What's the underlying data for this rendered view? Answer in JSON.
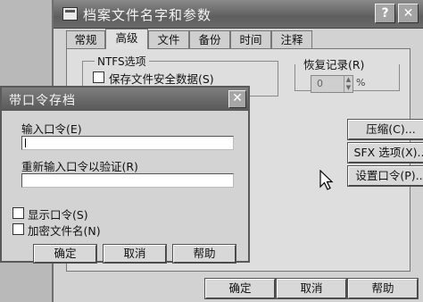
{
  "main": {
    "title": "档案文件名字和参数",
    "help_glyph": "?",
    "close_glyph": "✕",
    "tabs": [
      {
        "label": "常规",
        "active": false
      },
      {
        "label": "高级",
        "active": true
      },
      {
        "label": "文件",
        "active": false
      },
      {
        "label": "备份",
        "active": false
      },
      {
        "label": "时间",
        "active": false
      },
      {
        "label": "注释",
        "active": false
      }
    ],
    "ntfs_legend": "NTFS选项",
    "save_security_label": "保存文件安全数据(S)",
    "recovery_legend": "恢复记录(R)",
    "recovery_value": "0",
    "recovery_unit": "%",
    "compress_button": "压缩(C)...",
    "sfx_button": "SFX 选项(X)...",
    "set_password_button": "设置口令(P)...",
    "ok_button": "确定",
    "cancel_button": "取消",
    "help_button": "帮助"
  },
  "password": {
    "title": "带口令存档",
    "close_glyph": "✕",
    "enter_label": "输入口令(E)",
    "reenter_label": "重新输入口令以验证(R)",
    "show_label": "显示口令(S)",
    "encrypt_label": "加密文件名(N)",
    "ok_button": "确定",
    "cancel_button": "取消",
    "help_button": "帮助"
  },
  "icons": {
    "cursor": "mouse-pointer-icon",
    "archive": "archive-icon"
  }
}
